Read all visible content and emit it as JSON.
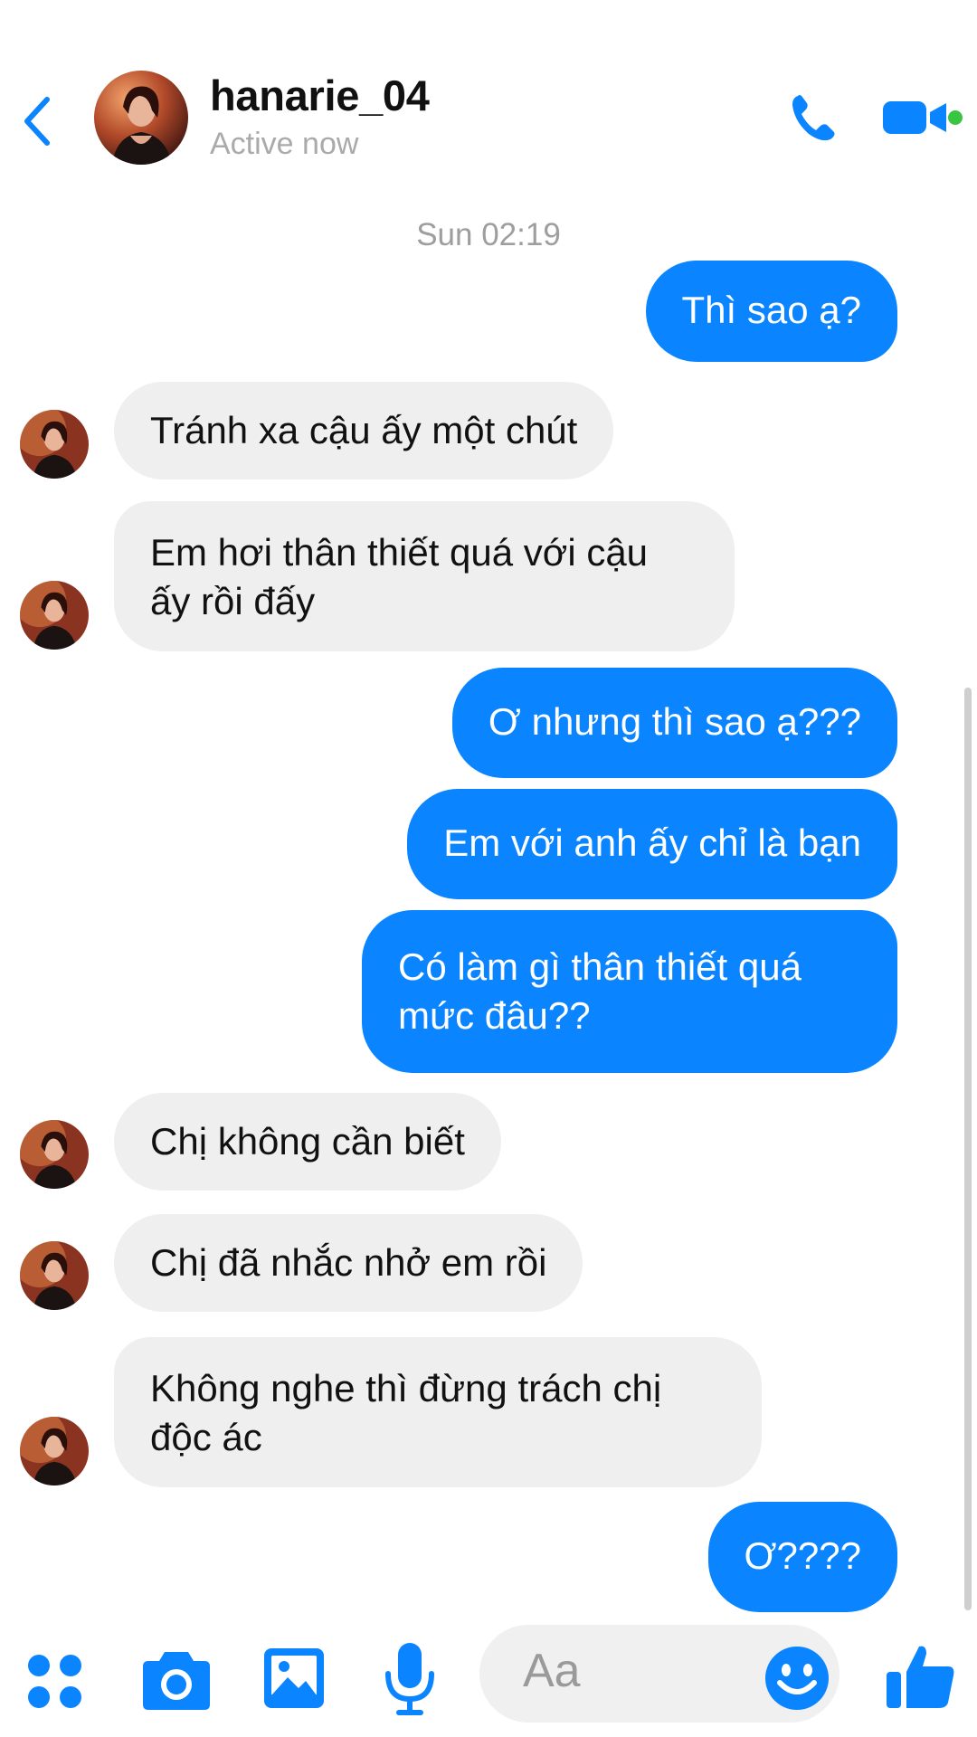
{
  "header": {
    "contact_name": "hanarie_04",
    "status": "Active now"
  },
  "conversation": {
    "timestamp": "Sun 02:19",
    "messages": [
      {
        "from": "me",
        "text": "Thì sao ạ?"
      },
      {
        "from": "them",
        "text": "Tránh xa cậu ấy một chút"
      },
      {
        "from": "them",
        "text": "Em hơi thân thiết quá với cậu\nấy rồi đấy"
      },
      {
        "from": "me",
        "text": "Ơ nhưng thì sao ạ???"
      },
      {
        "from": "me",
        "text": "Em với anh ấy chỉ là bạn"
      },
      {
        "from": "me",
        "text": "Có làm gì thân thiết quá\nmức đâu??"
      },
      {
        "from": "them",
        "text": "Chị không cần biết"
      },
      {
        "from": "them",
        "text": "Chị đã nhắc nhở em rồi"
      },
      {
        "from": "them",
        "text": "Không nghe thì đừng trách chị\nđộc ác"
      },
      {
        "from": "me",
        "text": "Ơ????"
      }
    ]
  },
  "composer": {
    "placeholder": "Aa"
  },
  "colors": {
    "accent": "#0a84ff",
    "received_bubble": "#efefef",
    "online": "#39c541"
  },
  "icons": [
    "back-chevron-icon",
    "phone-icon",
    "video-camera-icon",
    "apps-grid-icon",
    "camera-icon",
    "gallery-icon",
    "microphone-icon",
    "emoji-icon",
    "thumbs-up-icon"
  ]
}
